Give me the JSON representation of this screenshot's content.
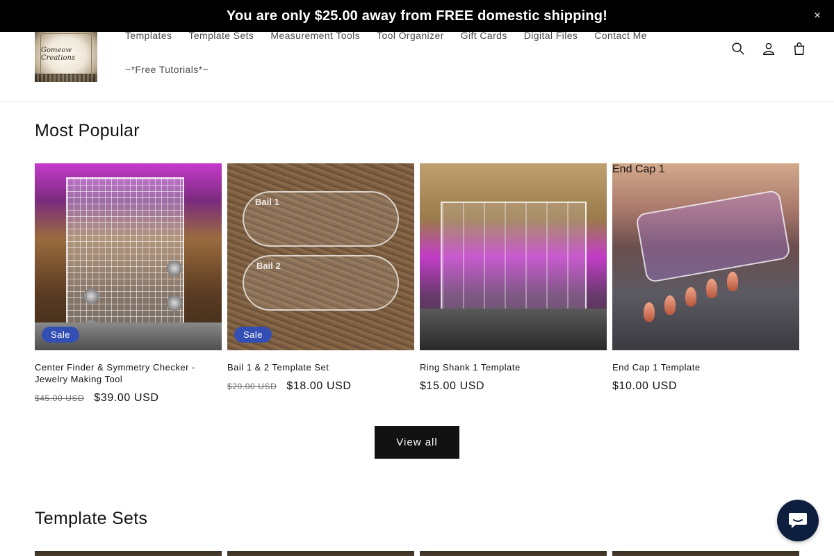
{
  "announcement": {
    "text": "You are only $25.00 away from FREE domestic shipping!",
    "close_label": "×"
  },
  "header": {
    "logo_alt": "Gomeow Creations",
    "nav_row1": [
      "Templates",
      "Template Sets",
      "Measurement Tools",
      "Tool Organizer",
      "Gift Cards",
      "Digital Files",
      "Contact Me"
    ],
    "nav_row2": [
      "~*Free Tutorials*~"
    ],
    "icons": [
      "search-icon",
      "account-icon",
      "cart-icon"
    ]
  },
  "most_popular": {
    "title": "Most Popular",
    "products": [
      {
        "title": "Center Finder & Symmetry Checker - Jewelry Making Tool",
        "old_price": "$45.00 USD",
        "price": "$39.00 USD",
        "badge": "Sale"
      },
      {
        "title": "Bail 1 & 2 Template Set",
        "old_price": "$20.00 USD",
        "price": "$18.00 USD",
        "badge": "Sale"
      },
      {
        "title": "Ring Shank 1 Template",
        "old_price": "",
        "price": "$15.00 USD",
        "badge": ""
      },
      {
        "title": "End Cap 1 Template",
        "old_price": "",
        "price": "$10.00 USD",
        "badge": ""
      }
    ],
    "image_labels": {
      "bail1": "Bail 1",
      "bail2": "Bail 2",
      "endcap": "End Cap 1"
    },
    "view_all": "View all"
  },
  "template_sets": {
    "title": "Template Sets"
  },
  "colors": {
    "announcement_bg": "#000000",
    "sale_badge": "#334fb4",
    "button_bg": "#121212",
    "chat_bg": "#0e1e3e"
  }
}
